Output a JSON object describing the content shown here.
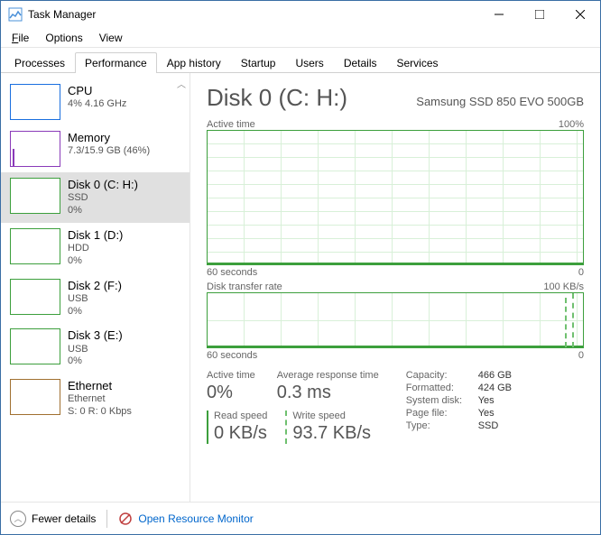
{
  "window": {
    "title": "Task Manager"
  },
  "menu": {
    "file": "File",
    "options": "Options",
    "view": "View"
  },
  "tabs": [
    "Processes",
    "Performance",
    "App history",
    "Startup",
    "Users",
    "Details",
    "Services"
  ],
  "sidebar": [
    {
      "name": "CPU",
      "sub1": "4% 4.16 GHz",
      "sub2": ""
    },
    {
      "name": "Memory",
      "sub1": "7.3/15.9 GB (46%)",
      "sub2": ""
    },
    {
      "name": "Disk 0 (C: H:)",
      "sub1": "SSD",
      "sub2": "0%"
    },
    {
      "name": "Disk 1 (D:)",
      "sub1": "HDD",
      "sub2": "0%"
    },
    {
      "name": "Disk 2 (F:)",
      "sub1": "USB",
      "sub2": "0%"
    },
    {
      "name": "Disk 3 (E:)",
      "sub1": "USB",
      "sub2": "0%"
    },
    {
      "name": "Ethernet",
      "sub1": "Ethernet",
      "sub2": "S: 0 R: 0 Kbps"
    }
  ],
  "main": {
    "title": "Disk 0 (C: H:)",
    "model": "Samsung SSD 850 EVO 500GB",
    "chart1": {
      "label": "Active time",
      "max": "100%",
      "xleft": "60 seconds",
      "xright": "0"
    },
    "chart2": {
      "label": "Disk transfer rate",
      "max": "100 KB/s",
      "xleft": "60 seconds",
      "xright": "0"
    },
    "stats": {
      "active_label": "Active time",
      "active_value": "0%",
      "avg_label": "Average response time",
      "avg_value": "0.3 ms",
      "read_label": "Read speed",
      "read_value": "0 KB/s",
      "write_label": "Write speed",
      "write_value": "93.7 KB/s"
    },
    "info": {
      "capacity_k": "Capacity:",
      "capacity_v": "466 GB",
      "formatted_k": "Formatted:",
      "formatted_v": "424 GB",
      "sysdisk_k": "System disk:",
      "sysdisk_v": "Yes",
      "pagefile_k": "Page file:",
      "pagefile_v": "Yes",
      "type_k": "Type:",
      "type_v": "SSD"
    }
  },
  "footer": {
    "fewer": "Fewer details",
    "monitor": "Open Resource Monitor"
  },
  "chart_data": [
    {
      "type": "line",
      "title": "Active time",
      "ylabel": "%",
      "ylim": [
        0,
        100
      ],
      "xlabel": "seconds",
      "xrange": [
        60,
        0
      ],
      "series": [
        {
          "name": "Active time",
          "values": [
            0,
            0,
            0,
            0,
            0,
            0,
            0,
            0,
            0,
            0,
            0,
            0
          ]
        }
      ]
    },
    {
      "type": "line",
      "title": "Disk transfer rate",
      "ylabel": "KB/s",
      "ylim": [
        0,
        100
      ],
      "xlabel": "seconds",
      "xrange": [
        60,
        0
      ],
      "series": [
        {
          "name": "Read",
          "values": [
            0,
            0,
            0,
            0,
            0,
            0,
            0,
            0,
            0,
            0,
            0,
            0
          ]
        },
        {
          "name": "Write",
          "values": [
            0,
            0,
            0,
            0,
            0,
            0,
            0,
            0,
            0,
            95,
            90,
            5
          ]
        }
      ]
    }
  ]
}
